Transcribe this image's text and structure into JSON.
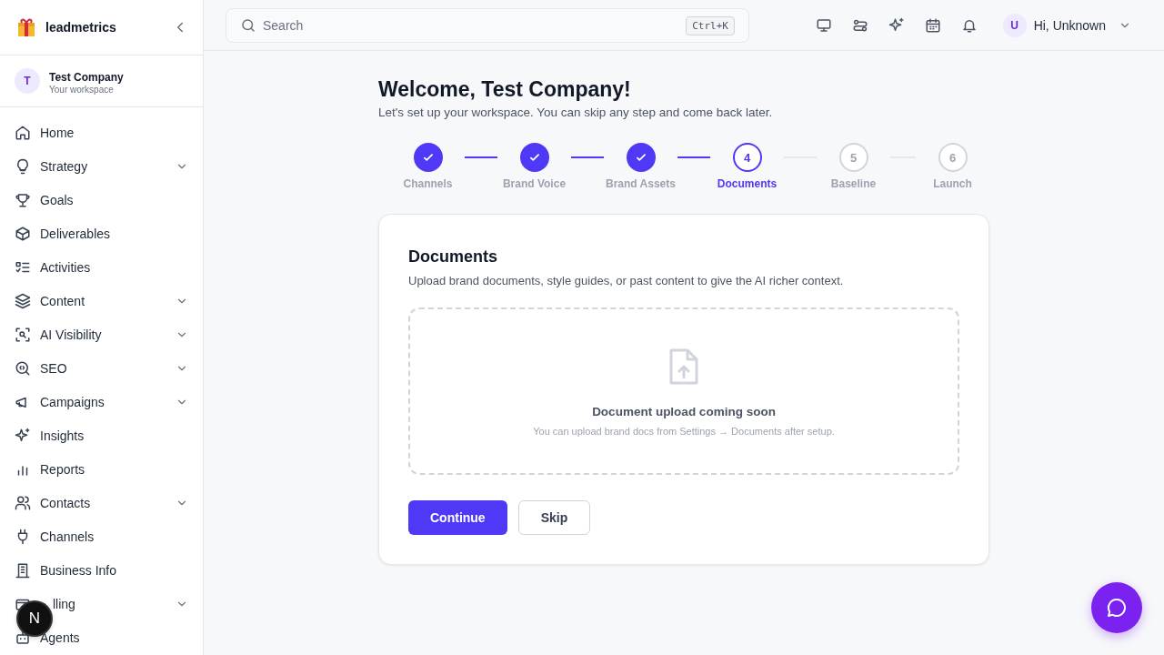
{
  "brand": {
    "name": "leadmetrics"
  },
  "workspace": {
    "initial": "T",
    "name": "Test Company",
    "subtitle": "Your workspace"
  },
  "sidebar": {
    "items": [
      {
        "label": "Home",
        "expandable": false
      },
      {
        "label": "Strategy",
        "expandable": true
      },
      {
        "label": "Goals",
        "expandable": false
      },
      {
        "label": "Deliverables",
        "expandable": false
      },
      {
        "label": "Activities",
        "expandable": false
      },
      {
        "label": "Content",
        "expandable": true
      },
      {
        "label": "AI Visibility",
        "expandable": true
      },
      {
        "label": "SEO",
        "expandable": true
      },
      {
        "label": "Campaigns",
        "expandable": true
      },
      {
        "label": "Insights",
        "expandable": false
      },
      {
        "label": "Reports",
        "expandable": false
      },
      {
        "label": "Contacts",
        "expandable": true
      },
      {
        "label": "Channels",
        "expandable": false
      },
      {
        "label": "Business Info",
        "expandable": false
      },
      {
        "label": "lling",
        "expandable": true
      },
      {
        "label": "Agents",
        "expandable": false
      }
    ]
  },
  "dev_badge": {
    "letter": "N"
  },
  "topbar": {
    "search": {
      "placeholder": "Search",
      "shortcut": "Ctrl+K"
    },
    "user": {
      "initial": "U",
      "greeting": "Hi, Unknown"
    }
  },
  "page": {
    "title": "Welcome, Test Company!",
    "subtitle": "Let's set up your workspace. You can skip any step and come back later."
  },
  "steps": [
    {
      "label": "Channels",
      "completed": true,
      "selected": false
    },
    {
      "label": "Brand Voice",
      "completed": true,
      "selected": false
    },
    {
      "label": "Brand Assets",
      "completed": true,
      "selected": false
    },
    {
      "label": "Documents",
      "number": "4",
      "completed": false,
      "selected": true
    },
    {
      "label": "Baseline",
      "number": "5",
      "completed": false,
      "selected": false
    },
    {
      "label": "Launch",
      "number": "6",
      "completed": false,
      "selected": false
    }
  ],
  "card": {
    "title": "Documents",
    "description": "Upload brand documents, style guides, or past content to give the AI richer context.",
    "dropzone": {
      "title": "Document upload coming soon",
      "note": "You can upload brand docs from Settings → Documents after setup."
    },
    "buttons": [
      {
        "label": "Continue",
        "kind": "primary"
      },
      {
        "label": "Skip",
        "kind": "secondary"
      }
    ]
  }
}
